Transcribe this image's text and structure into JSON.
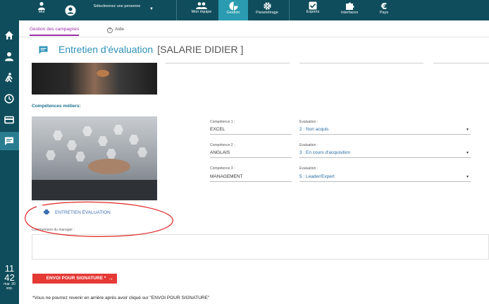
{
  "topbar": {
    "moi": "Moi",
    "person_select": "Sélectionnez une personne",
    "mon_equipe": "Mon équipe",
    "gestion": "Gestion",
    "parametrage": "Paramétrage",
    "exports": "Exports",
    "interfaces": "Interfaces",
    "pays": "Pays"
  },
  "sidebar": {
    "items": [
      "home-icon",
      "user-icon",
      "person-walk-icon",
      "clock-icon",
      "card-icon",
      "chat-icon"
    ],
    "clock_time": "11",
    "clock_minutes": "42",
    "clock_date": "mar. 20 sep."
  },
  "tabs": {
    "campagnes": "Gestion des campagnes",
    "aide": "Aide"
  },
  "header": {
    "title": "Entretien d'évaluation",
    "salarie": "[SALARIE DIDIER ]"
  },
  "competences": {
    "heading": "Compétences métiers:",
    "items": [
      {
        "label": "Compétence 1 :",
        "value": "EXCEL",
        "eval_label": "Evaluation :",
        "eval_value": "2 : Non acquis"
      },
      {
        "label": "Compétence 2 :",
        "value": "ANGLAIS",
        "eval_label": "Evaluation :",
        "eval_value": "3 : En cours d'acquisition"
      },
      {
        "label": "Compétence 3 :",
        "value": "MANAGEMENT",
        "eval_label": "Evaluation :",
        "eval_value": "5 : Leader/Expert"
      }
    ]
  },
  "entretien_link": "ENTRETIEN ÉVALUATION",
  "comment_label": "Commentaire du manager :",
  "sign_button": "ENVOI POUR SIGNATURE *",
  "footnote": "*Vous ne pourrez revenir en arrière après avoir cliqué sur \"ENVOI POUR SIGNATURE\"",
  "colors": {
    "topbar": "#0f4d5c",
    "active_tab": "#2a9bb0",
    "title": "#2e92b8",
    "accent_purple": "#9b2ea8",
    "button_red": "#e53935",
    "annotation_red": "#e02424"
  }
}
